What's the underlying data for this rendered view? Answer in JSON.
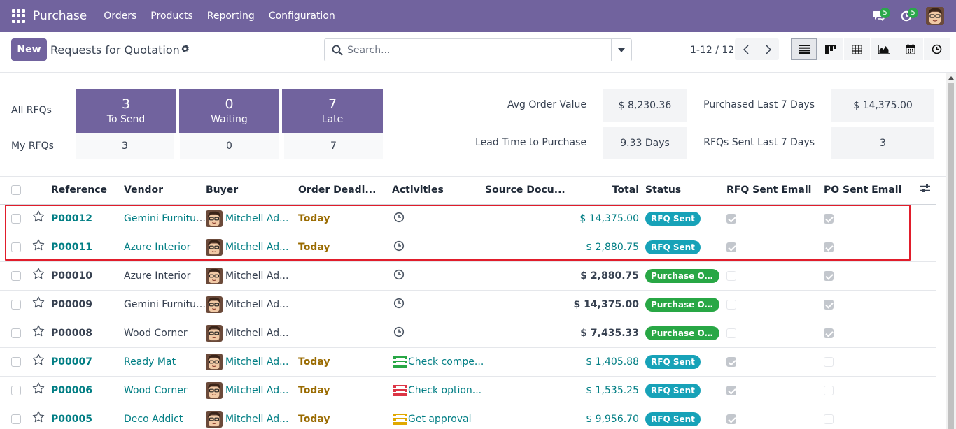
{
  "navbar": {
    "brand": "Purchase",
    "menu": [
      "Orders",
      "Products",
      "Reporting",
      "Configuration"
    ],
    "messages_badge": "5",
    "activities_badge": "5"
  },
  "control": {
    "new_label": "New",
    "title": "Requests for Quotation",
    "search_placeholder": "Search...",
    "pager": "1-12 / 12"
  },
  "dashboard": {
    "all_rfqs_label": "All RFQs",
    "my_rfqs_label": "My RFQs",
    "tiles": [
      {
        "num": "3",
        "label": "To Send"
      },
      {
        "num": "0",
        "label": "Waiting"
      },
      {
        "num": "7",
        "label": "Late"
      }
    ],
    "my": [
      "3",
      "0",
      "7"
    ],
    "kpis": {
      "avg_order_label": "Avg Order Value",
      "avg_order_value": "$ 8,230.36",
      "purchased_label": "Purchased Last 7 Days",
      "purchased_value": "$ 14,375.00",
      "lead_label": "Lead Time to Purchase",
      "lead_value": "9.33 Days",
      "sent_label": "RFQs Sent Last 7 Days",
      "sent_value": "3"
    }
  },
  "table": {
    "headers": {
      "reference": "Reference",
      "vendor": "Vendor",
      "buyer": "Buyer",
      "deadline": "Order Deadl...",
      "activities": "Activities",
      "source": "Source Docu...",
      "total": "Total",
      "status": "Status",
      "rfq_email": "RFQ Sent Email",
      "po_email": "PO Sent Email"
    },
    "rows": [
      {
        "ref": "P00012",
        "vendor": "Gemini Furniture",
        "buyer": "Mitchell Ad...",
        "deadline": "Today",
        "activity": "clock",
        "activity_text": "",
        "total": "$ 14,375.00",
        "status": "RFQ Sent",
        "rfq": true,
        "po": true,
        "rfq_state": true
      },
      {
        "ref": "P00011",
        "vendor": "Azure Interior",
        "buyer": "Mitchell Ad...",
        "deadline": "Today",
        "activity": "clock",
        "activity_text": "",
        "total": "$ 2,880.75",
        "status": "RFQ Sent",
        "rfq": true,
        "po": true,
        "rfq_state": true
      },
      {
        "ref": "P00010",
        "vendor": "Azure Interior",
        "buyer": "Mitchell Ad...",
        "deadline": "",
        "activity": "clock",
        "activity_text": "",
        "total": "$ 2,880.75",
        "status": "Purchase Or...",
        "rfq": false,
        "po": true,
        "rfq_state": false
      },
      {
        "ref": "P00009",
        "vendor": "Gemini Furniture",
        "buyer": "Mitchell Ad...",
        "deadline": "",
        "activity": "clock",
        "activity_text": "",
        "total": "$ 14,375.00",
        "status": "Purchase Or...",
        "rfq": false,
        "po": true,
        "rfq_state": false
      },
      {
        "ref": "P00008",
        "vendor": "Wood Corner",
        "buyer": "Mitchell Ad...",
        "deadline": "",
        "activity": "clock",
        "activity_text": "",
        "total": "$ 7,435.33",
        "status": "Purchase Or...",
        "rfq": false,
        "po": true,
        "rfq_state": false
      },
      {
        "ref": "P00007",
        "vendor": "Ready Mat",
        "buyer": "Mitchell Ad...",
        "deadline": "Today",
        "activity": "green",
        "activity_text": "Check compe...",
        "total": "$ 1,405.88",
        "status": "RFQ Sent",
        "rfq": true,
        "po": false,
        "rfq_state": true
      },
      {
        "ref": "P00006",
        "vendor": "Wood Corner",
        "buyer": "Mitchell Ad...",
        "deadline": "Today",
        "activity": "red",
        "activity_text": "Check option...",
        "total": "$ 1,535.25",
        "status": "RFQ Sent",
        "rfq": true,
        "po": false,
        "rfq_state": true
      },
      {
        "ref": "P00005",
        "vendor": "Deco Addict",
        "buyer": "Mitchell Ad...",
        "deadline": "Today",
        "activity": "yellow",
        "activity_text": "Get approval",
        "total": "$ 9,956.70",
        "status": "RFQ Sent",
        "rfq": true,
        "po": false,
        "rfq_state": true
      }
    ]
  },
  "colors": {
    "brand": "#71639e",
    "link": "#017e84",
    "today": "#9a6b01",
    "rfq_pill": "#17a2b8",
    "po_pill": "#28a745",
    "highlight": "#e11d2b"
  }
}
